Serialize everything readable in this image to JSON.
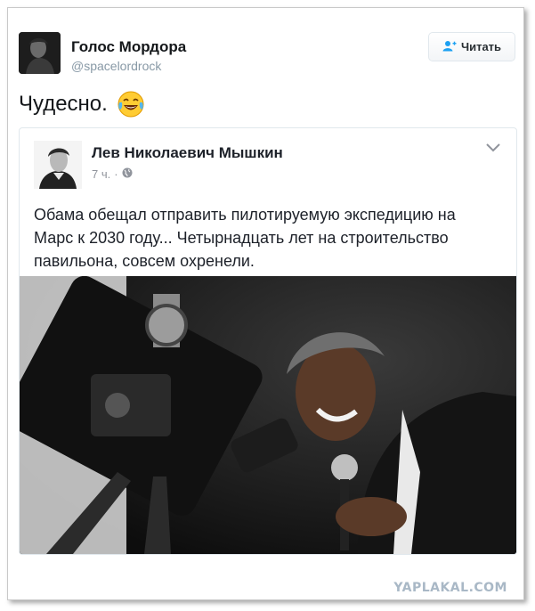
{
  "tweet": {
    "author_name": "Голос Мордора",
    "author_handle": "@spacelordrock",
    "follow_label": "Читать",
    "text": "Чудесно.",
    "emoji": "tears-of-joy-emoji"
  },
  "card": {
    "author_name": "Лев Николаевич Мышкин",
    "time": "7 ч.",
    "separator": "·",
    "text": "Обама обещал отправить пилотируемую экспедицию на Марс к 2030 году... Четырнадцать лет на строительство павильона, совсем охренели.",
    "photo": "man-looking-through-telescope-photo"
  },
  "watermark": "YAPLAKAL.COM",
  "colors": {
    "follow_icon": "#1da1f2",
    "handle": "#8899a6",
    "meta": "#90949c",
    "watermark": "#a9b8c6"
  }
}
